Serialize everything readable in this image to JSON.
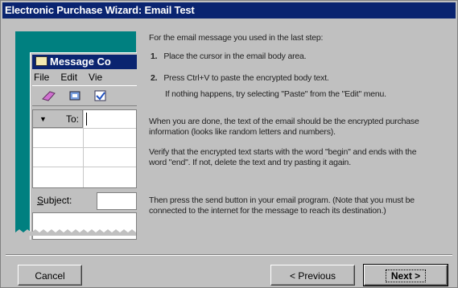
{
  "window": {
    "title": "Electronic Purchase Wizard: Email Test"
  },
  "illustration": {
    "title": "Message Co",
    "menu": [
      "File",
      "Edit",
      "Vie"
    ],
    "to_label": "To:",
    "subject_label": "Subject:"
  },
  "instructions": {
    "intro": "For the email message you used in the last step:",
    "step1_num": "1.",
    "step1": "Place the cursor in the email body area.",
    "step2_num": "2.",
    "step2": "Press Ctrl+V to paste the encrypted body text.",
    "step2_note": "If nothing happens, try selecting \"Paste\" from the \"Edit\" menu.",
    "done_line1": "When you are done, the text of the email should be the encrypted purchase",
    "done_line2": "information (looks like random letters and numbers).",
    "verify_line1": "Verify that the encrypted text starts with the word \"begin\" and ends with the",
    "verify_line2": "word \"end\". If not, delete the text and try pasting it again.",
    "send_line1": "Then press the send button in your email program. (Note that you must be",
    "send_line2": "connected to the internet for the message to reach its destination.)"
  },
  "buttons": {
    "cancel": "Cancel",
    "previous": "< Previous",
    "next": "Next >"
  },
  "colors": {
    "titlebar": "#0a2470",
    "illustration_bg": "#008080",
    "dialog_bg": "#c0c0c0"
  }
}
